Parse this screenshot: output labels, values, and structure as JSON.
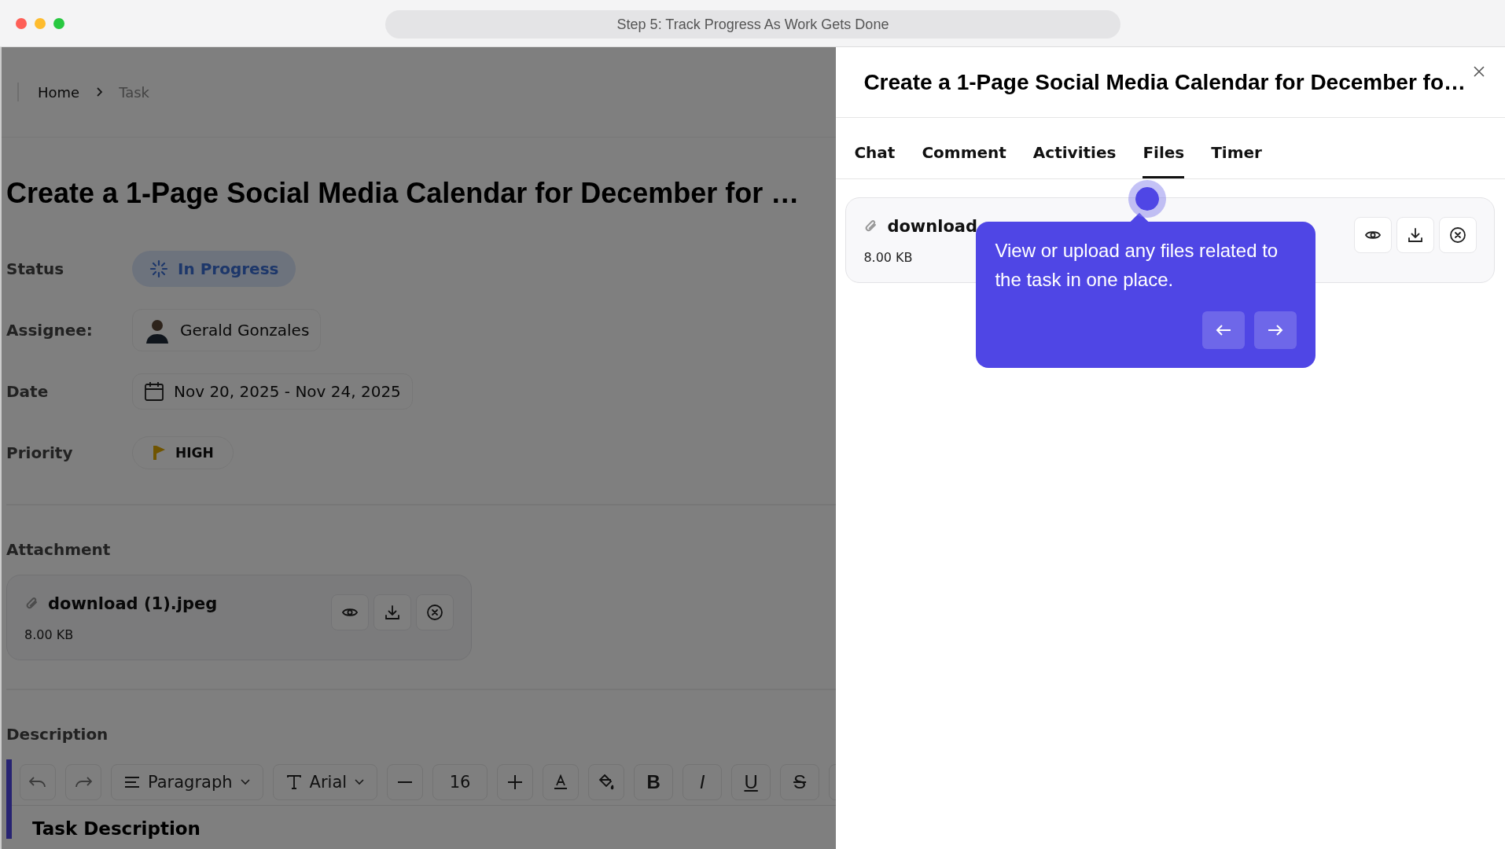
{
  "window": {
    "title": "Step 5: Track Progress As Work Gets Done"
  },
  "breadcrumb": [
    "Home",
    "Task"
  ],
  "task": {
    "title": "Create a 1-Page Social Media Calendar for December for …",
    "fields": [
      {
        "kind": "status",
        "label": "Status",
        "value": "In Progress"
      },
      {
        "kind": "assignee",
        "label": "Assignee:",
        "value": "Gerald Gonzales"
      },
      {
        "kind": "date",
        "label": "Date",
        "value": "Nov 20, 2025 - Nov 24, 2025"
      },
      {
        "kind": "priority",
        "label": "Priority",
        "value": "HIGH"
      }
    ]
  },
  "attachment": {
    "heading": "Attachment",
    "file": {
      "name": "download (1).jpeg",
      "size": "8.00 KB"
    }
  },
  "description": {
    "heading": "Description",
    "block_style": "Paragraph",
    "font": "Arial",
    "font_size": "16",
    "format_buttons": [
      {
        "kind": "bold",
        "label": "B"
      },
      {
        "kind": "italic",
        "label": "I"
      },
      {
        "kind": "underline",
        "label": "U"
      },
      {
        "kind": "strike",
        "label": "S"
      }
    ],
    "content_heading": "Task Description"
  },
  "panel": {
    "title": "Create a 1-Page Social Media Calendar for December fo…",
    "tabs": [
      {
        "label": "Chat",
        "selected": false
      },
      {
        "label": "Comment",
        "selected": false
      },
      {
        "label": "Activities",
        "selected": false
      },
      {
        "label": "Files",
        "selected": true
      },
      {
        "label": "Timer",
        "selected": false
      }
    ],
    "file": {
      "name": "download",
      "size": "8.00 KB"
    }
  },
  "tour_tooltip": {
    "text": "View or upload any files related to the task in one place."
  }
}
